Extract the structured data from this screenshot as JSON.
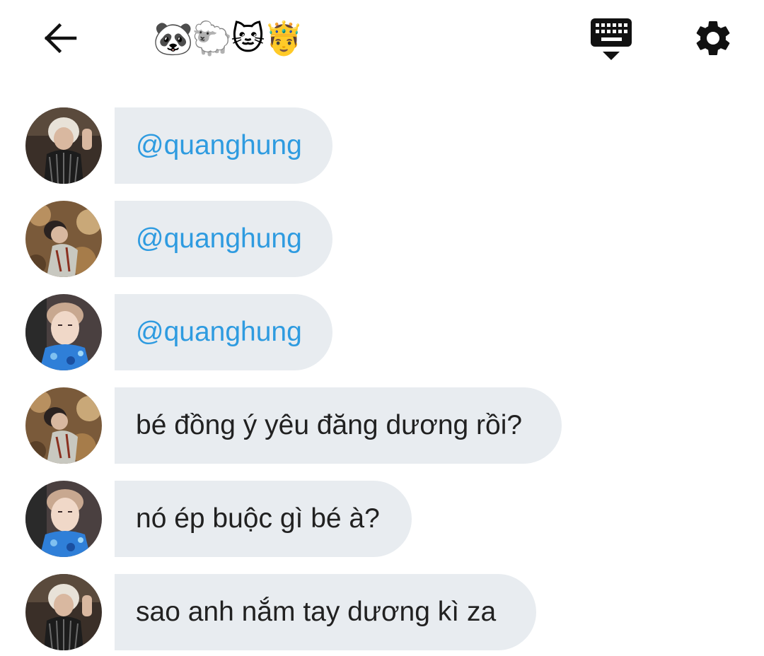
{
  "header": {
    "title": "🐼🐑🐱🤴",
    "back_icon": "arrow-left-icon",
    "keyboard_icon": "keyboard-hide-icon",
    "settings_icon": "gear-icon"
  },
  "colors": {
    "bubble_bg": "#e8ecf0",
    "mention_text": "#2e9be0",
    "body_text": "#212121",
    "icon": "#111111"
  },
  "messages": [
    {
      "avatar": "avatar-1",
      "text": "@quanghung",
      "type": "mention"
    },
    {
      "avatar": "avatar-2",
      "text": "@quanghung",
      "type": "mention"
    },
    {
      "avatar": "avatar-3",
      "text": "@quanghung",
      "type": "mention"
    },
    {
      "avatar": "avatar-2",
      "text": "bé đồng ý yêu đăng dương rồi?",
      "type": "text"
    },
    {
      "avatar": "avatar-3",
      "text": "nó ép buộc gì bé à?",
      "type": "text"
    },
    {
      "avatar": "avatar-1",
      "text": "sao anh nắm tay dương kì za",
      "type": "text"
    }
  ]
}
